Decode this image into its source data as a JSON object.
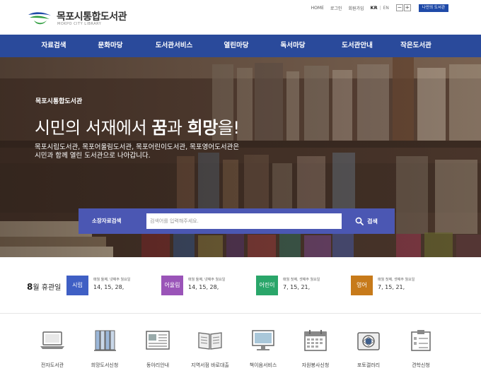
{
  "header": {
    "logo_title": "목포시통합도서관",
    "logo_subtitle": "MOKPO CITY LIBRARY",
    "util_links": [
      "HOME",
      "로그인",
      "회원가입"
    ],
    "lang_kr": "KR",
    "lang_sep": "|",
    "lang_en": "EN",
    "zoom_out": "−",
    "zoom_in": "+",
    "my_library": "나만의 도서관"
  },
  "nav": {
    "items": [
      "자료검색",
      "문화마당",
      "도서관서비스",
      "열린마당",
      "독서마당",
      "도서관안내",
      "작은도서관"
    ]
  },
  "hero": {
    "label": "목포시통합도서관",
    "headline_pre": "시민의 서재에서 ",
    "headline_bold1": "꿈",
    "headline_mid": "과 ",
    "headline_bold2": "희망",
    "headline_post": "을!",
    "desc_line1": "목포시립도서관, 목포어울림도서관, 목포어린이도서관, 목포영어도서관은",
    "desc_line2": "시민과 함께 열린 도서관으로 나아갑니다."
  },
  "search": {
    "label": "소장자료검색",
    "placeholder": "검색어를 입력해주세요.",
    "button": "검색"
  },
  "holidays": {
    "month": "8",
    "title_suffix": "월 휴관일",
    "groups": [
      {
        "name": "시립",
        "color": "#3f5fc4",
        "note": "매월 둘째, 넷째주 월요일",
        "days": "14, 15, 28,"
      },
      {
        "name": "어울림",
        "color": "#9a54b8",
        "note": "매월 둘째, 넷째주 월요일",
        "days": "14, 15, 28,"
      },
      {
        "name": "어린이",
        "color": "#2aa66a",
        "note": "매월 첫째, 셋째주 월요일",
        "days": "7, 15, 21,"
      },
      {
        "name": "영어",
        "color": "#c77a1a",
        "note": "매월 첫째, 셋째주 월요일",
        "days": "7, 15, 21,"
      }
    ]
  },
  "services": {
    "items": [
      {
        "label": "전자도서관",
        "icon": "laptop-icon"
      },
      {
        "label": "희망도서신청",
        "icon": "books-icon"
      },
      {
        "label": "동아리안내",
        "icon": "bulletin-icon"
      },
      {
        "label": "지역서점 바로대출",
        "icon": "open-book-icon"
      },
      {
        "label": "책이음서비스",
        "icon": "monitor-icon"
      },
      {
        "label": "자원봉사신청",
        "icon": "calendar-icon"
      },
      {
        "label": "포토갤러리",
        "icon": "camera-icon"
      },
      {
        "label": "견학신청",
        "icon": "clipboard-icon"
      }
    ]
  }
}
